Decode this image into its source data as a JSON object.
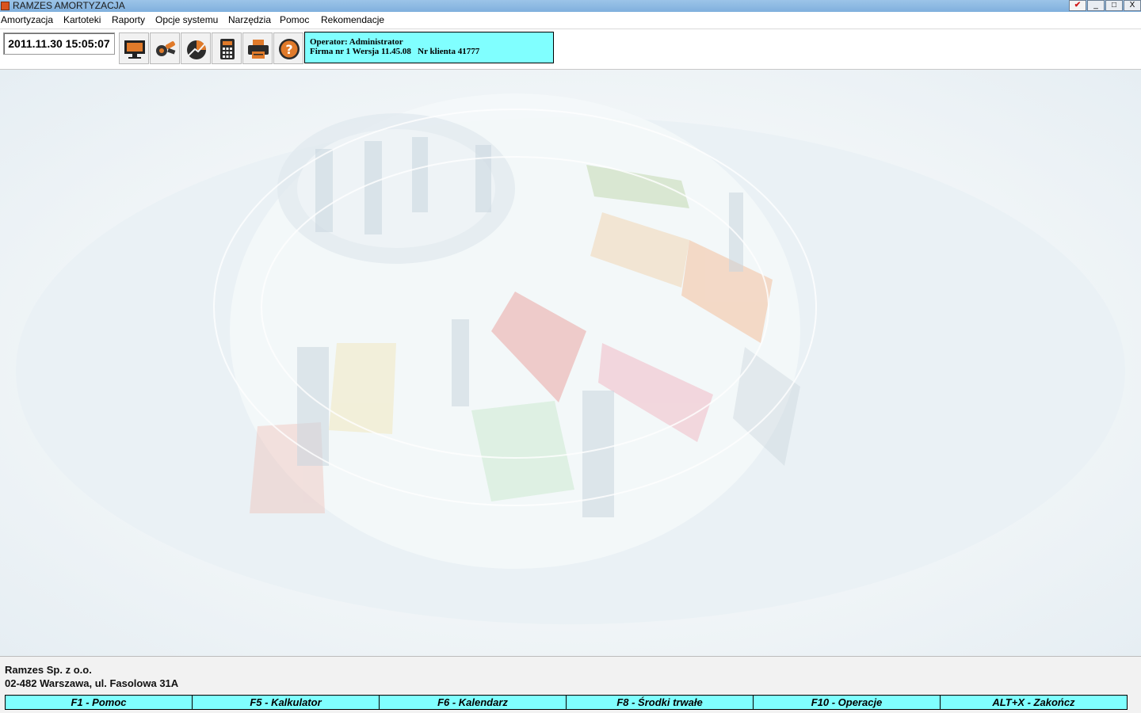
{
  "window": {
    "title": "RAMZES AMORTYZACJA",
    "controls": [
      "_",
      "□",
      "X"
    ]
  },
  "menu": [
    "Amortyzacja",
    "Kartoteki",
    "Raporty",
    "Opcje systemu",
    "Narzędzia",
    "Pomoc",
    "Rekomendacje"
  ],
  "toolbar": {
    "datetime": "2011.11.30 15:05:07",
    "buttons": [
      "monitor-icon",
      "tools-icon",
      "chart-icon",
      "calculator-icon",
      "printer-icon",
      "help-icon"
    ]
  },
  "operator": {
    "line1": "Operator: Administrator",
    "line2": "Firma nr 1 Wersja 11.45.08   Nr klienta 41777"
  },
  "company": {
    "name": "Ramzes Sp. z o.o.",
    "address": "02-482 Warszawa, ul. Fasolowa 31A"
  },
  "fkeys": [
    "F1 - Pomoc",
    "F5 - Kalkulator",
    "F6 - Kalendarz",
    "F8 - Środki trwałe",
    "F10 - Operacje",
    "ALT+X - Zakończ"
  ]
}
